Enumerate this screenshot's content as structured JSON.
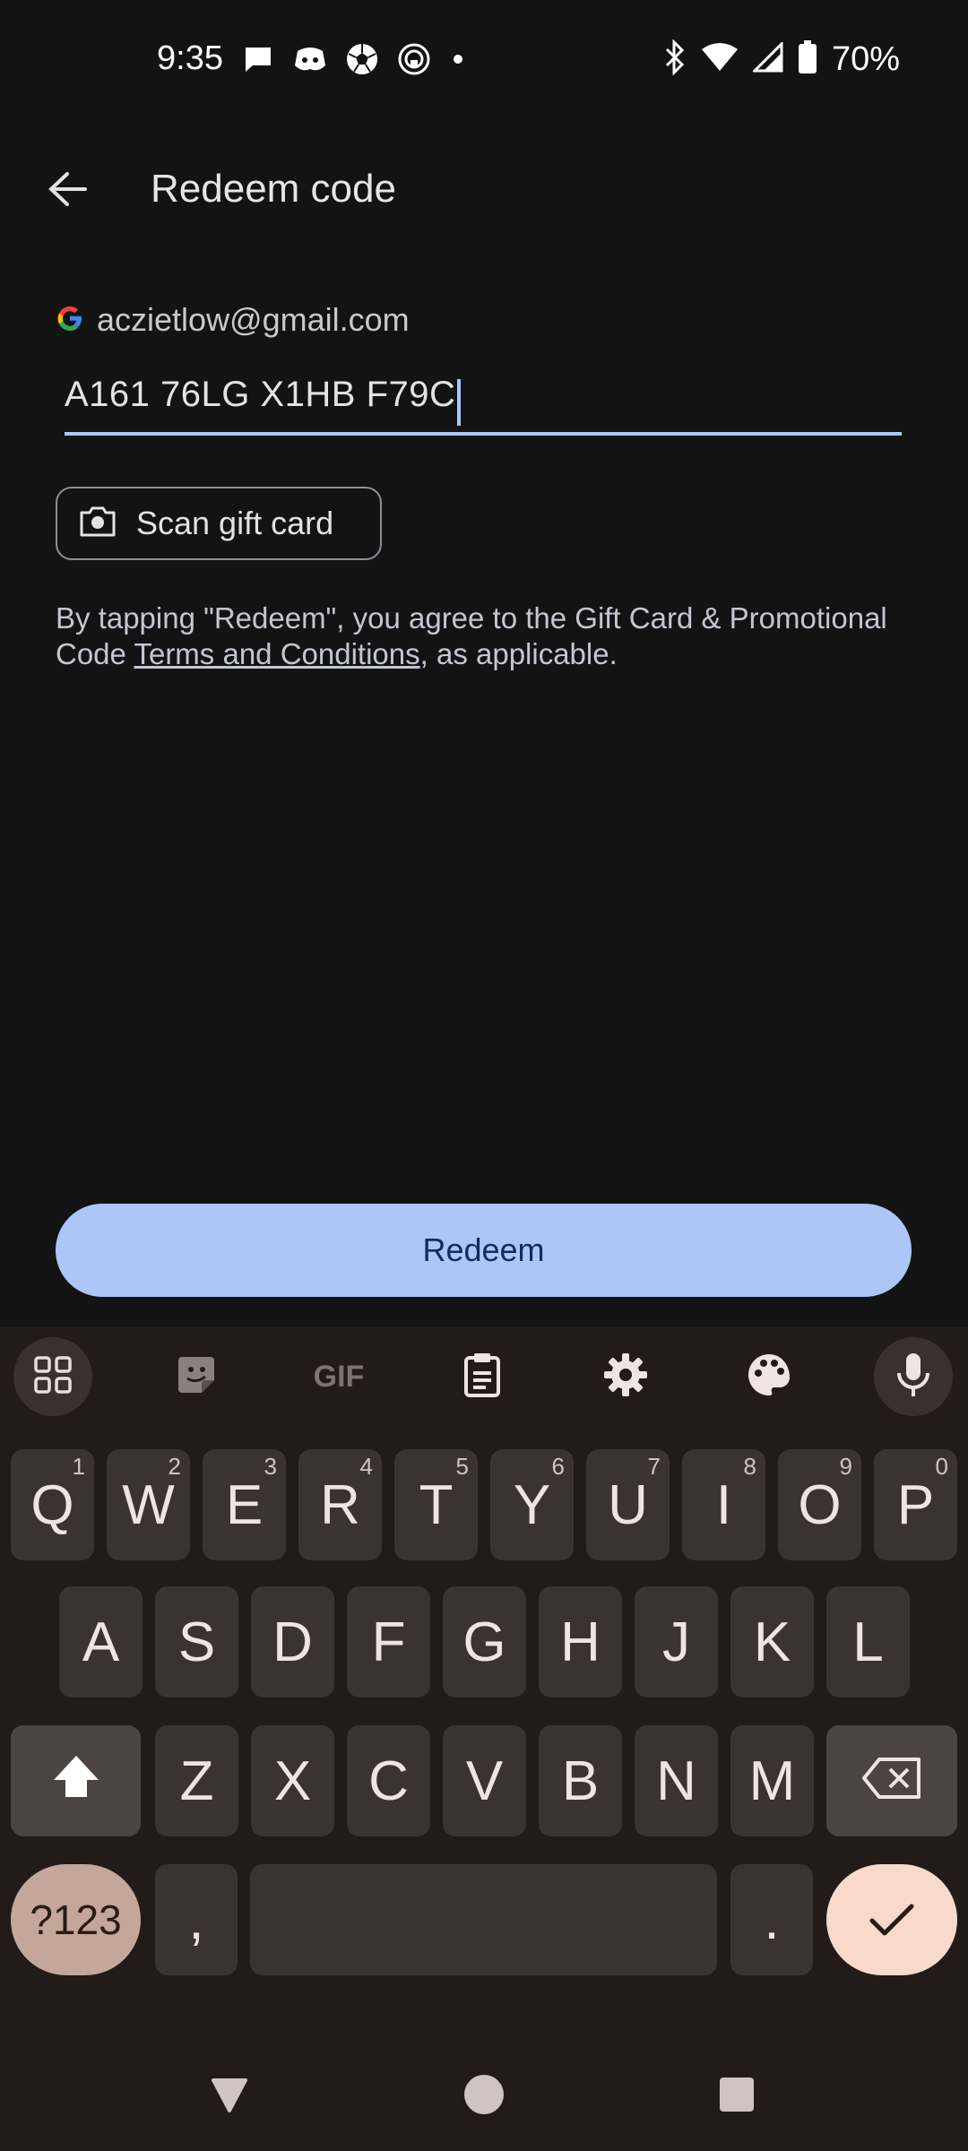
{
  "status_bar": {
    "time": "9:35",
    "left_icons": [
      "messages-icon",
      "discord-icon",
      "soccer-icon",
      "ring-app-icon",
      "more-dot-icon"
    ],
    "right_icons": [
      "bluetooth-icon",
      "wifi-icon",
      "cell-signal-icon",
      "battery-icon"
    ],
    "battery": "70%"
  },
  "header": {
    "title": "Redeem code",
    "back_icon": "arrow-back-icon"
  },
  "account": {
    "email": "aczietlow@gmail.com",
    "icon": "google-g-icon"
  },
  "code_field": {
    "value": "A161 76LG X1HB F79C"
  },
  "scan_button": {
    "label": "Scan gift card",
    "icon": "camera-icon"
  },
  "terms": {
    "before": "By tapping \"Redeem\", you agree to the Gift Card & Promotional Code ",
    "link": "Terms and Conditions",
    "after": ", as applicable."
  },
  "redeem_button": {
    "label": "Redeem"
  },
  "keyboard": {
    "toolbar": [
      "apps-grid-icon",
      "sticker-icon",
      "gif-icon",
      "clipboard-icon",
      "settings-icon",
      "palette-icon",
      "mic-icon"
    ],
    "gif_label": "GIF",
    "row1": [
      {
        "k": "Q",
        "h": "1"
      },
      {
        "k": "W",
        "h": "2"
      },
      {
        "k": "E",
        "h": "3"
      },
      {
        "k": "R",
        "h": "4"
      },
      {
        "k": "T",
        "h": "5"
      },
      {
        "k": "Y",
        "h": "6"
      },
      {
        "k": "U",
        "h": "7"
      },
      {
        "k": "I",
        "h": "8"
      },
      {
        "k": "O",
        "h": "9"
      },
      {
        "k": "P",
        "h": "0"
      }
    ],
    "row2": [
      "A",
      "S",
      "D",
      "F",
      "G",
      "H",
      "J",
      "K",
      "L"
    ],
    "row3": [
      "Z",
      "X",
      "C",
      "V",
      "B",
      "N",
      "M"
    ],
    "symbols_label": "?123",
    "comma": ",",
    "period": "."
  },
  "nav_bar": [
    "back-triangle-icon",
    "home-circle-icon",
    "recents-square-icon"
  ],
  "colors": {
    "background": "#131314",
    "accent": "#aac7ff",
    "redeem_button": "#adc6f7",
    "keyboard_bg": "#231b1a",
    "enter_key": "#f8d9cb"
  }
}
